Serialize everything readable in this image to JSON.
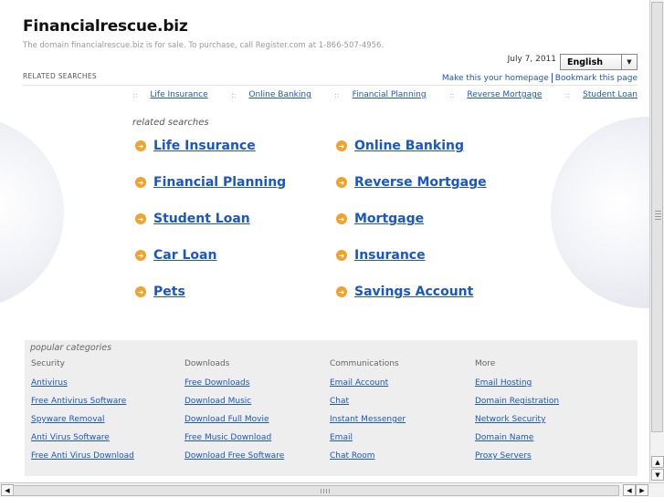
{
  "header": {
    "title": "Financialrescue.biz",
    "subtitle": "The domain financialrescue.biz is for sale. To purchase, call Register.com at 1-866-507-4956.",
    "date": "July 7, 2011",
    "language": "English",
    "related_label": "RELATED SEARCHES",
    "homepage_link": "Make this your homepage",
    "bookmark_link": "Bookmark this page"
  },
  "topnav": [
    "Life Insurance",
    "Online Banking",
    "Financial Planning",
    "Reverse Mortgage",
    "Student Loan"
  ],
  "related": {
    "label": "related searches",
    "left": [
      "Life Insurance",
      "Financial Planning",
      "Student Loan",
      "Car Loan",
      "Pets"
    ],
    "right": [
      "Online Banking",
      "Reverse Mortgage",
      "Mortgage",
      "Insurance",
      "Savings Account"
    ]
  },
  "popular": {
    "title": "popular categories",
    "columns": [
      {
        "head": "Security",
        "links": [
          "Antivirus",
          "Free Antivirus Software",
          "Spyware Removal",
          "Anti Virus Software",
          "Free Anti Virus Download"
        ]
      },
      {
        "head": "Downloads",
        "links": [
          "Free Downloads",
          "Download Music",
          "Download Full Movie",
          "Free Music Download",
          "Download Free Software"
        ]
      },
      {
        "head": "Communications",
        "links": [
          "Email Account",
          "Chat",
          "Instant Messenger",
          "Email",
          "Chat Room"
        ]
      },
      {
        "head": "More",
        "links": [
          "Email Hosting",
          "Domain Registration",
          "Network Security",
          "Domain Name",
          "Proxy Servers"
        ]
      }
    ]
  },
  "colors": {
    "link": "#1a56c9",
    "bullet": "#f0a22b",
    "panel": "#eeeeee"
  }
}
